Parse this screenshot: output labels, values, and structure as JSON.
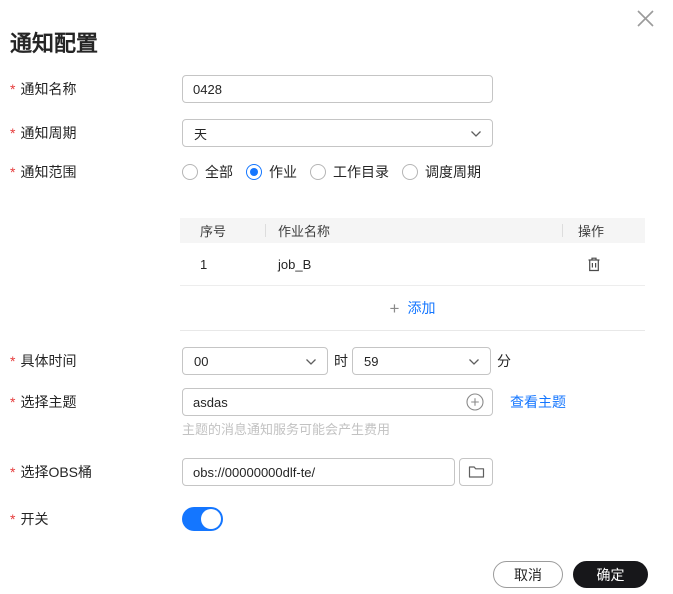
{
  "dialog": {
    "title": "通知配置"
  },
  "misc": {
    "required_marker": "*"
  },
  "fields": {
    "name": {
      "label": "通知名称",
      "value": "0428"
    },
    "period": {
      "label": "通知周期",
      "value": "天"
    },
    "scope": {
      "label": "通知范围",
      "options": [
        {
          "label": "全部",
          "selected": false
        },
        {
          "label": "作业",
          "selected": true
        },
        {
          "label": "工作目录",
          "selected": false
        },
        {
          "label": "调度周期",
          "selected": false
        }
      ]
    },
    "time": {
      "label": "具体时间",
      "hour": "00",
      "hour_unit": "时",
      "minute": "59",
      "minute_unit": "分"
    },
    "topic": {
      "label": "选择主题",
      "value": "asdas",
      "view_link": "查看主题",
      "helper": "主题的消息通知服务可能会产生费用"
    },
    "obs": {
      "label": "选择OBS桶",
      "value": "obs://00000000dlf-te/"
    },
    "switch": {
      "label": "开关",
      "state": "on"
    }
  },
  "job_table": {
    "columns": {
      "no": "序号",
      "name": "作业名称",
      "action": "操作"
    },
    "rows": [
      {
        "no": "1",
        "name": "job_B"
      }
    ],
    "add_plus": "+",
    "add_label": "添加"
  },
  "footer": {
    "cancel": "取消",
    "confirm": "确定"
  },
  "colors": {
    "accent_blue": "#1476ff",
    "required_red": "#e63b3b",
    "confirm_bg": "#17171a",
    "table_header_bg": "#f5f5f5"
  }
}
